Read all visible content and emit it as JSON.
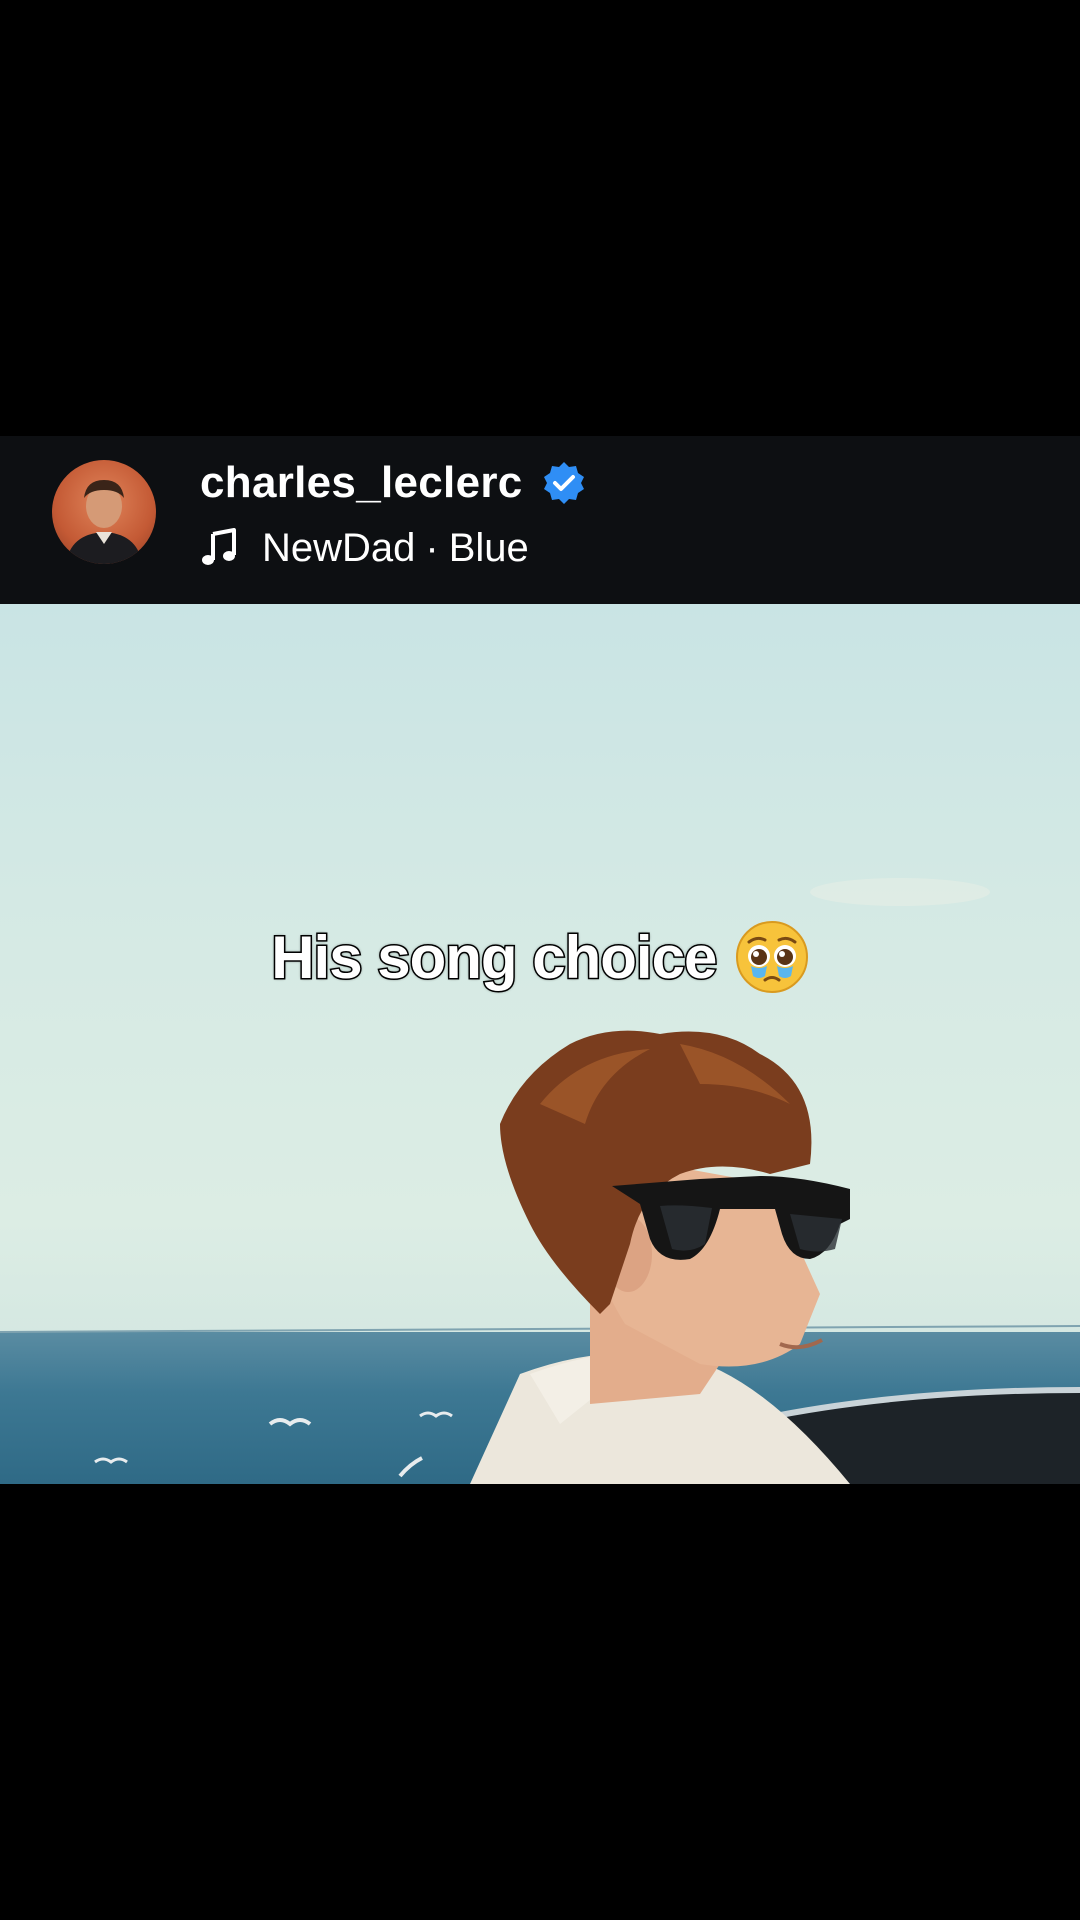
{
  "post": {
    "username": "charles_leclerc",
    "verified": true,
    "music": {
      "artist": "NewDad",
      "separator": "·",
      "track": "Blue"
    }
  },
  "video": {
    "caption": "His song choice",
    "caption_emoji_icon": "pleading-face-emoji-icon"
  },
  "icons": {
    "verified": "verified-badge-icon",
    "music": "music-note-icon",
    "avatar": "profile-avatar"
  },
  "colors": {
    "background": "#000000",
    "header_bg": "#0d0f12",
    "verified_blue": "#2f8ef5",
    "text": "#ffffff"
  }
}
